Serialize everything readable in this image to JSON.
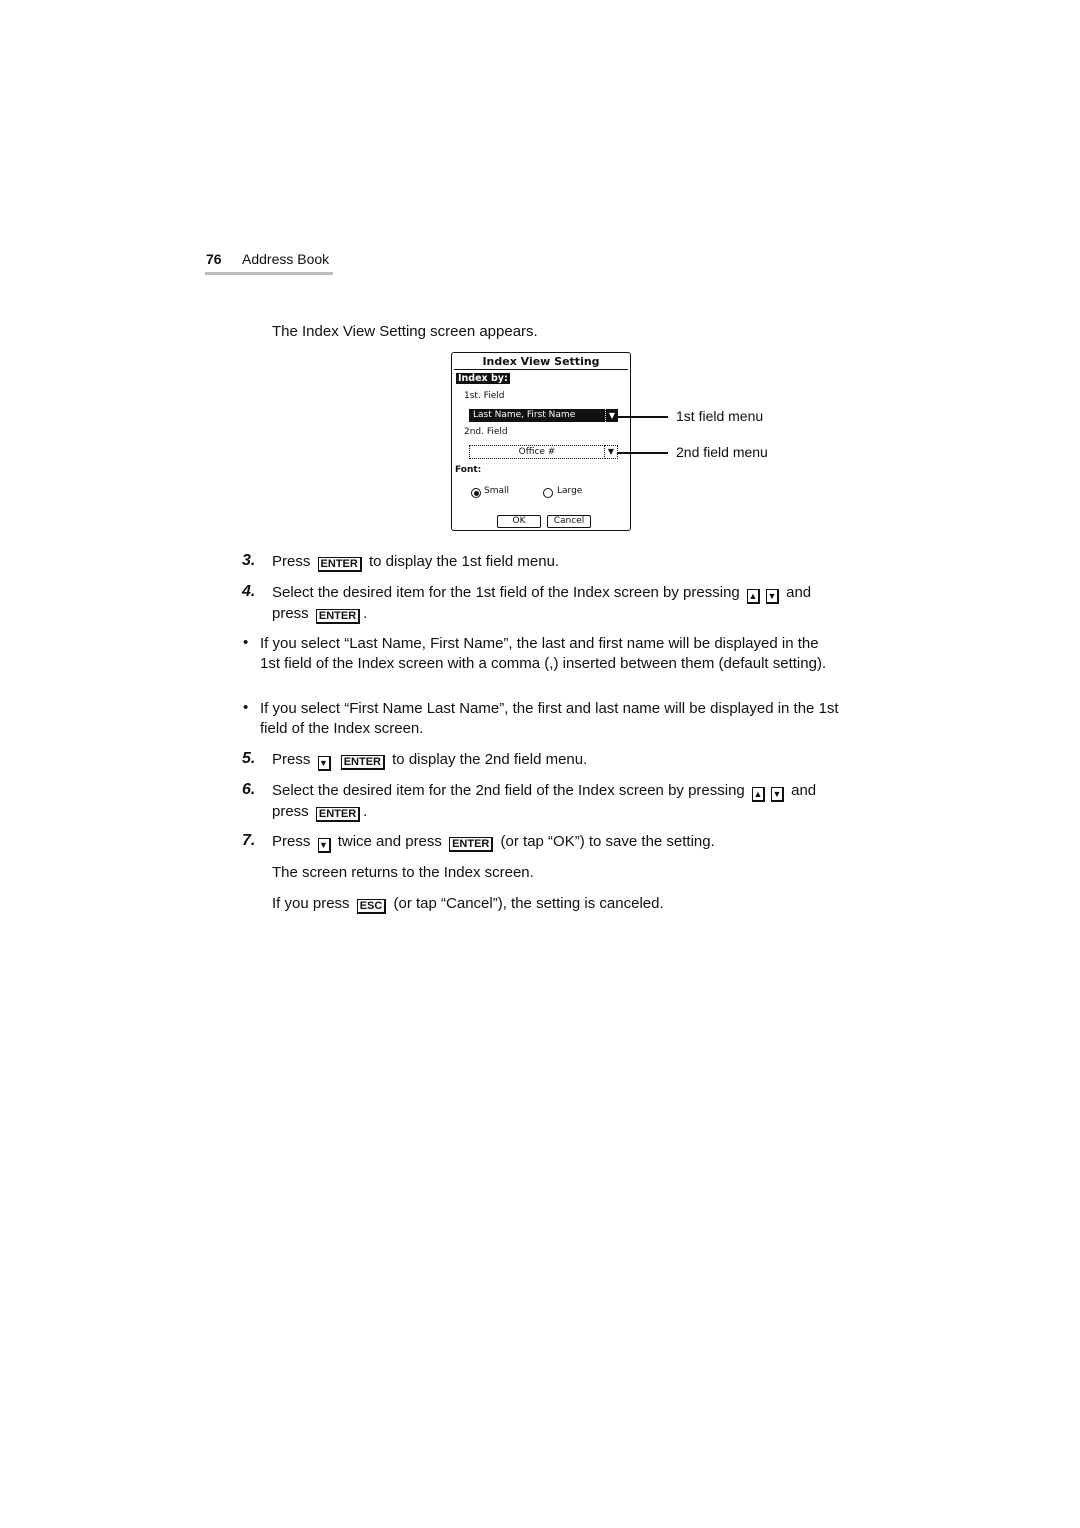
{
  "header": {
    "page_number": "76",
    "section": "Address Book"
  },
  "intro": "The Index View Setting screen appears.",
  "dialog": {
    "title": "Index View Setting",
    "index_by": "Index by:",
    "first_field_label": "1st. Field",
    "first_field_value": "Last Name, First Name",
    "second_field_label": "2nd. Field",
    "second_field_value": "Office #",
    "font_label": "Font:",
    "font_options": [
      {
        "label": "Small",
        "selected": true
      },
      {
        "label": "Large",
        "selected": false
      }
    ],
    "ok": "OK",
    "cancel": "Cancel",
    "dropdown_icon": "▼"
  },
  "callouts": {
    "first": "1st field menu",
    "second": "2nd field menu"
  },
  "keys": {
    "enter": "ENTER",
    "esc": "ESC",
    "up": "▲",
    "down": "▼"
  },
  "steps": {
    "s3": {
      "num": "3.",
      "a": "Press",
      "b": "to display the 1st field menu."
    },
    "s4": {
      "num": "4.",
      "a": "Select the desired item for the 1st field of the Index screen by pressing",
      "b": "and press",
      "c": "."
    },
    "b1": "If you select “Last Name, First Name”, the last and first name will be displayed in the 1st field of the Index screen with a comma (,) inserted between them (default setting).",
    "b2": "If you select “First Name Last Name”, the first and last name will be displayed in the 1st field of the Index screen.",
    "s5": {
      "num": "5.",
      "a": "Press",
      "b": "to display the 2nd field menu."
    },
    "s6": {
      "num": "6.",
      "a": "Select the desired item for the 2nd field of the Index screen by pressing",
      "b": "and press",
      "c": "."
    },
    "s7": {
      "num": "7.",
      "a": "Press",
      "b": "twice and press",
      "c": "(or tap “OK”) to save the setting."
    },
    "returns": "The screen returns to the Index screen.",
    "esc": {
      "a": "If you press",
      "b": "(or tap “Cancel”), the setting is canceled."
    }
  },
  "bullet_char": "•"
}
